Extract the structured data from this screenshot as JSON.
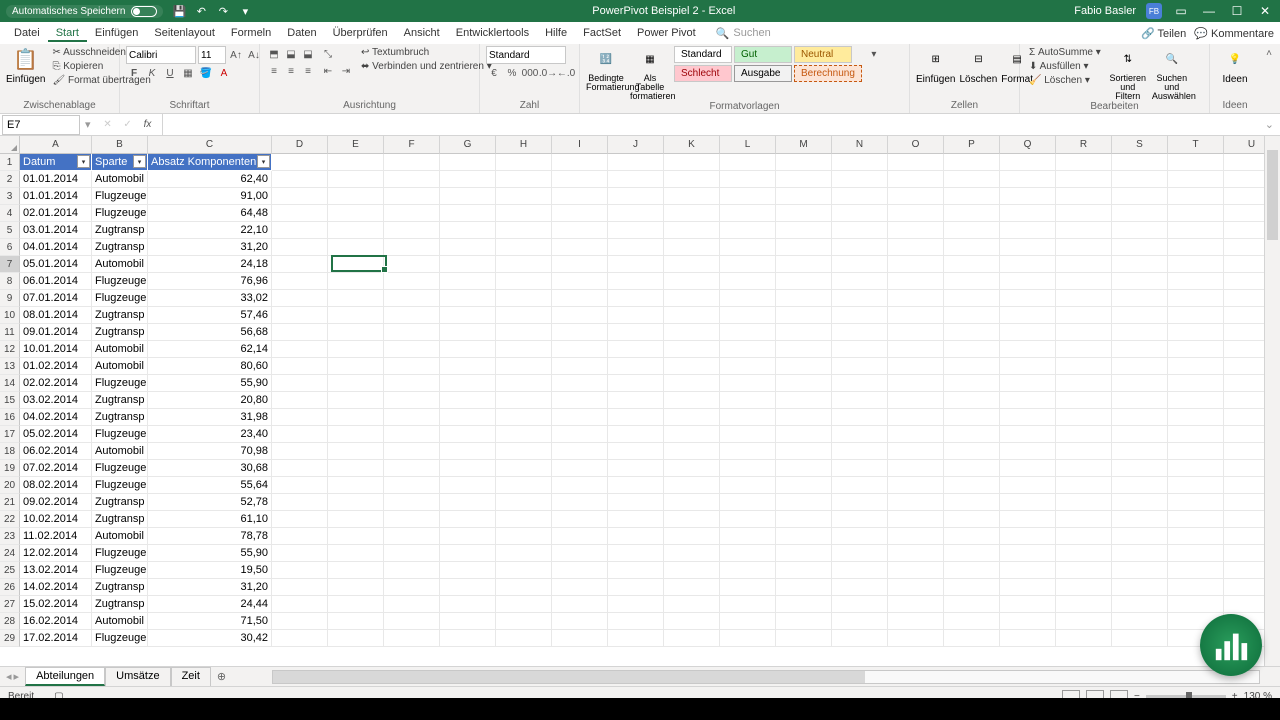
{
  "titlebar": {
    "autosave_label": "Automatisches Speichern",
    "doc_title": "PowerPivot Beispiel 2 - Excel",
    "user_name": "Fabio Basler",
    "user_initials": "FB"
  },
  "menu": {
    "items": [
      "Datei",
      "Start",
      "Einfügen",
      "Seitenlayout",
      "Formeln",
      "Daten",
      "Überprüfen",
      "Ansicht",
      "Entwicklertools",
      "Hilfe",
      "FactSet",
      "Power Pivot"
    ],
    "active_index": 1,
    "search_placeholder": "Suchen",
    "share": "Teilen",
    "comments": "Kommentare"
  },
  "ribbon": {
    "clipboard": {
      "paste": "Einfügen",
      "cut": "Ausschneiden",
      "copy": "Kopieren",
      "format_painter": "Format übertragen",
      "label": "Zwischenablage"
    },
    "font": {
      "name": "Calibri",
      "size": "11",
      "label": "Schriftart"
    },
    "alignment": {
      "wrap": "Textumbruch",
      "merge": "Verbinden und zentrieren",
      "label": "Ausrichtung"
    },
    "number": {
      "format": "Standard",
      "label": "Zahl"
    },
    "styles": {
      "cond": "Bedingte Formatierung",
      "table": "Als Tabelle formatieren",
      "s1": "Standard",
      "s2": "Gut",
      "s3": "Neutral",
      "s4": "Schlecht",
      "s5": "Ausgabe",
      "s6": "Berechnung",
      "label": "Formatvorlagen"
    },
    "cells": {
      "insert": "Einfügen",
      "delete": "Löschen",
      "format": "Format",
      "label": "Zellen"
    },
    "editing": {
      "sum": "AutoSumme",
      "fill": "Ausfüllen",
      "clear": "Löschen",
      "sort": "Sortieren und Filtern",
      "find": "Suchen und Auswählen",
      "label": "Bearbeiten"
    },
    "ideas": {
      "label": "Ideen"
    }
  },
  "formula_bar": {
    "name_box": "E7",
    "formula": ""
  },
  "columns": [
    "A",
    "B",
    "C",
    "D",
    "E",
    "F",
    "G",
    "H",
    "I",
    "J",
    "K",
    "L",
    "M",
    "N",
    "O",
    "P",
    "Q",
    "R",
    "S",
    "T",
    "U"
  ],
  "col_widths": {
    "A": 72,
    "B": 56,
    "C": 124,
    "default": 56
  },
  "headers": {
    "A": "Datum",
    "B": "Sparte",
    "C": "Absatz Komponenten"
  },
  "rows": [
    {
      "n": 2,
      "a": "01.01.2014",
      "b": "Automobil",
      "c": "62,40"
    },
    {
      "n": 3,
      "a": "01.01.2014",
      "b": "Flugzeuge",
      "c": "91,00"
    },
    {
      "n": 4,
      "a": "02.01.2014",
      "b": "Flugzeuge",
      "c": "64,48"
    },
    {
      "n": 5,
      "a": "03.01.2014",
      "b": "Zugtransp",
      "c": "22,10"
    },
    {
      "n": 6,
      "a": "04.01.2014",
      "b": "Zugtransp",
      "c": "31,20"
    },
    {
      "n": 7,
      "a": "05.01.2014",
      "b": "Automobil",
      "c": "24,18"
    },
    {
      "n": 8,
      "a": "06.01.2014",
      "b": "Flugzeuge",
      "c": "76,96"
    },
    {
      "n": 9,
      "a": "07.01.2014",
      "b": "Flugzeuge",
      "c": "33,02"
    },
    {
      "n": 10,
      "a": "08.01.2014",
      "b": "Zugtransp",
      "c": "57,46"
    },
    {
      "n": 11,
      "a": "09.01.2014",
      "b": "Zugtransp",
      "c": "56,68"
    },
    {
      "n": 12,
      "a": "10.01.2014",
      "b": "Automobil",
      "c": "62,14"
    },
    {
      "n": 13,
      "a": "01.02.2014",
      "b": "Automobil",
      "c": "80,60"
    },
    {
      "n": 14,
      "a": "02.02.2014",
      "b": "Flugzeuge",
      "c": "55,90"
    },
    {
      "n": 15,
      "a": "03.02.2014",
      "b": "Zugtransp",
      "c": "20,80"
    },
    {
      "n": 16,
      "a": "04.02.2014",
      "b": "Zugtransp",
      "c": "31,98"
    },
    {
      "n": 17,
      "a": "05.02.2014",
      "b": "Flugzeuge",
      "c": "23,40"
    },
    {
      "n": 18,
      "a": "06.02.2014",
      "b": "Automobil",
      "c": "70,98"
    },
    {
      "n": 19,
      "a": "07.02.2014",
      "b": "Flugzeuge",
      "c": "30,68"
    },
    {
      "n": 20,
      "a": "08.02.2014",
      "b": "Flugzeuge",
      "c": "55,64"
    },
    {
      "n": 21,
      "a": "09.02.2014",
      "b": "Zugtransp",
      "c": "52,78"
    },
    {
      "n": 22,
      "a": "10.02.2014",
      "b": "Zugtransp",
      "c": "61,10"
    },
    {
      "n": 23,
      "a": "11.02.2014",
      "b": "Automobil",
      "c": "78,78"
    },
    {
      "n": 24,
      "a": "12.02.2014",
      "b": "Flugzeuge",
      "c": "55,90"
    },
    {
      "n": 25,
      "a": "13.02.2014",
      "b": "Flugzeuge",
      "c": "19,50"
    },
    {
      "n": 26,
      "a": "14.02.2014",
      "b": "Zugtransp",
      "c": "31,20"
    },
    {
      "n": 27,
      "a": "15.02.2014",
      "b": "Zugtransp",
      "c": "24,44"
    },
    {
      "n": 28,
      "a": "16.02.2014",
      "b": "Automobil",
      "c": "71,50"
    },
    {
      "n": 29,
      "a": "17.02.2014",
      "b": "Flugzeuge",
      "c": "30,42"
    }
  ],
  "selection": {
    "cell": "E7",
    "row": 7,
    "col": "E"
  },
  "sheets": {
    "tabs": [
      "Abteilungen",
      "Umsätze",
      "Zeit"
    ],
    "active": 0
  },
  "status": {
    "ready": "Bereit",
    "zoom": "130 %"
  }
}
